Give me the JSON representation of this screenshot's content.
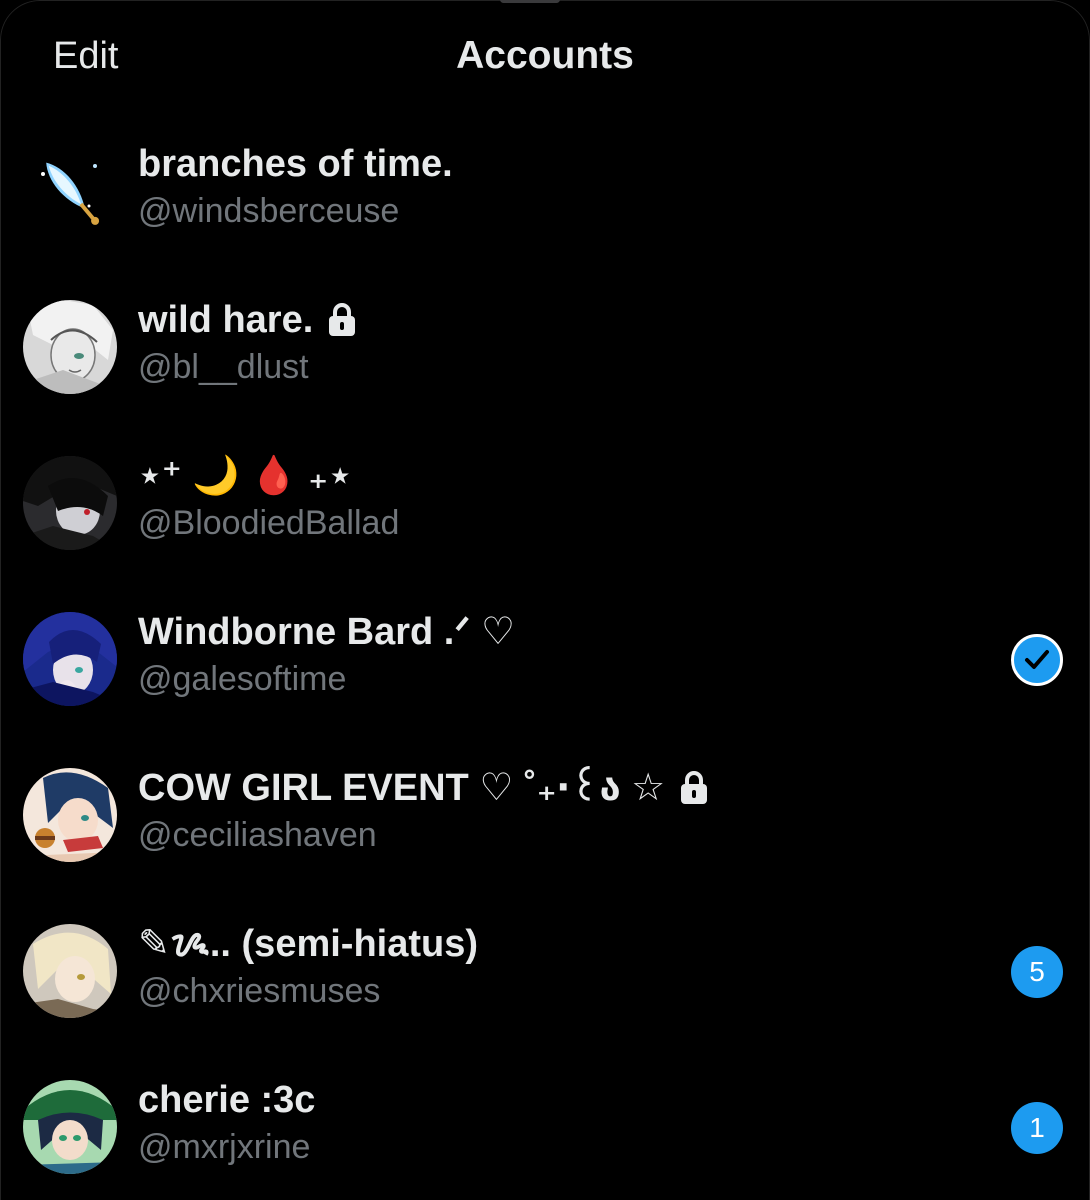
{
  "header": {
    "edit_label": "Edit",
    "title": "Accounts"
  },
  "accounts": [
    {
      "display_name": "branches of time.",
      "handle": "@windsberceuse",
      "protected": false,
      "active": false,
      "badge": "",
      "avatar_icon": "feather-icon"
    },
    {
      "display_name": "wild hare.",
      "handle": "@bl__dlust",
      "protected": true,
      "active": false,
      "badge": "",
      "avatar_icon": "sketch-portrait"
    },
    {
      "display_name": "⋆⁺ 🌙 🩸 ₊⋆",
      "handle": "@BloodiedBallad",
      "protected": false,
      "active": false,
      "badge": "",
      "avatar_icon": "dark-portrait"
    },
    {
      "display_name": "Windborne Bard .ᐟ ♡",
      "handle": "@galesoftime",
      "protected": false,
      "active": true,
      "badge": "",
      "avatar_icon": "blue-hair-portrait"
    },
    {
      "display_name": "COW GIRL EVENT ♡ ˚₊‧꒰ა ☆",
      "handle": "@ceciliashaven",
      "protected": true,
      "active": false,
      "badge": "",
      "avatar_icon": "teal-hair-portrait"
    },
    {
      "display_name": "✎ᝰ.. (semi-hiatus)",
      "handle": "@chxriesmuses",
      "protected": false,
      "active": false,
      "badge": "5",
      "avatar_icon": "blonde-portrait"
    },
    {
      "display_name": "cherie :3c",
      "handle": "@mxrjxrine",
      "protected": false,
      "active": false,
      "badge": "1",
      "avatar_icon": "green-hat-portrait"
    }
  ],
  "colors": {
    "background": "#000000",
    "primary_text": "#e7e9ea",
    "secondary_text": "#71767b",
    "accent": "#1d9bf0"
  }
}
